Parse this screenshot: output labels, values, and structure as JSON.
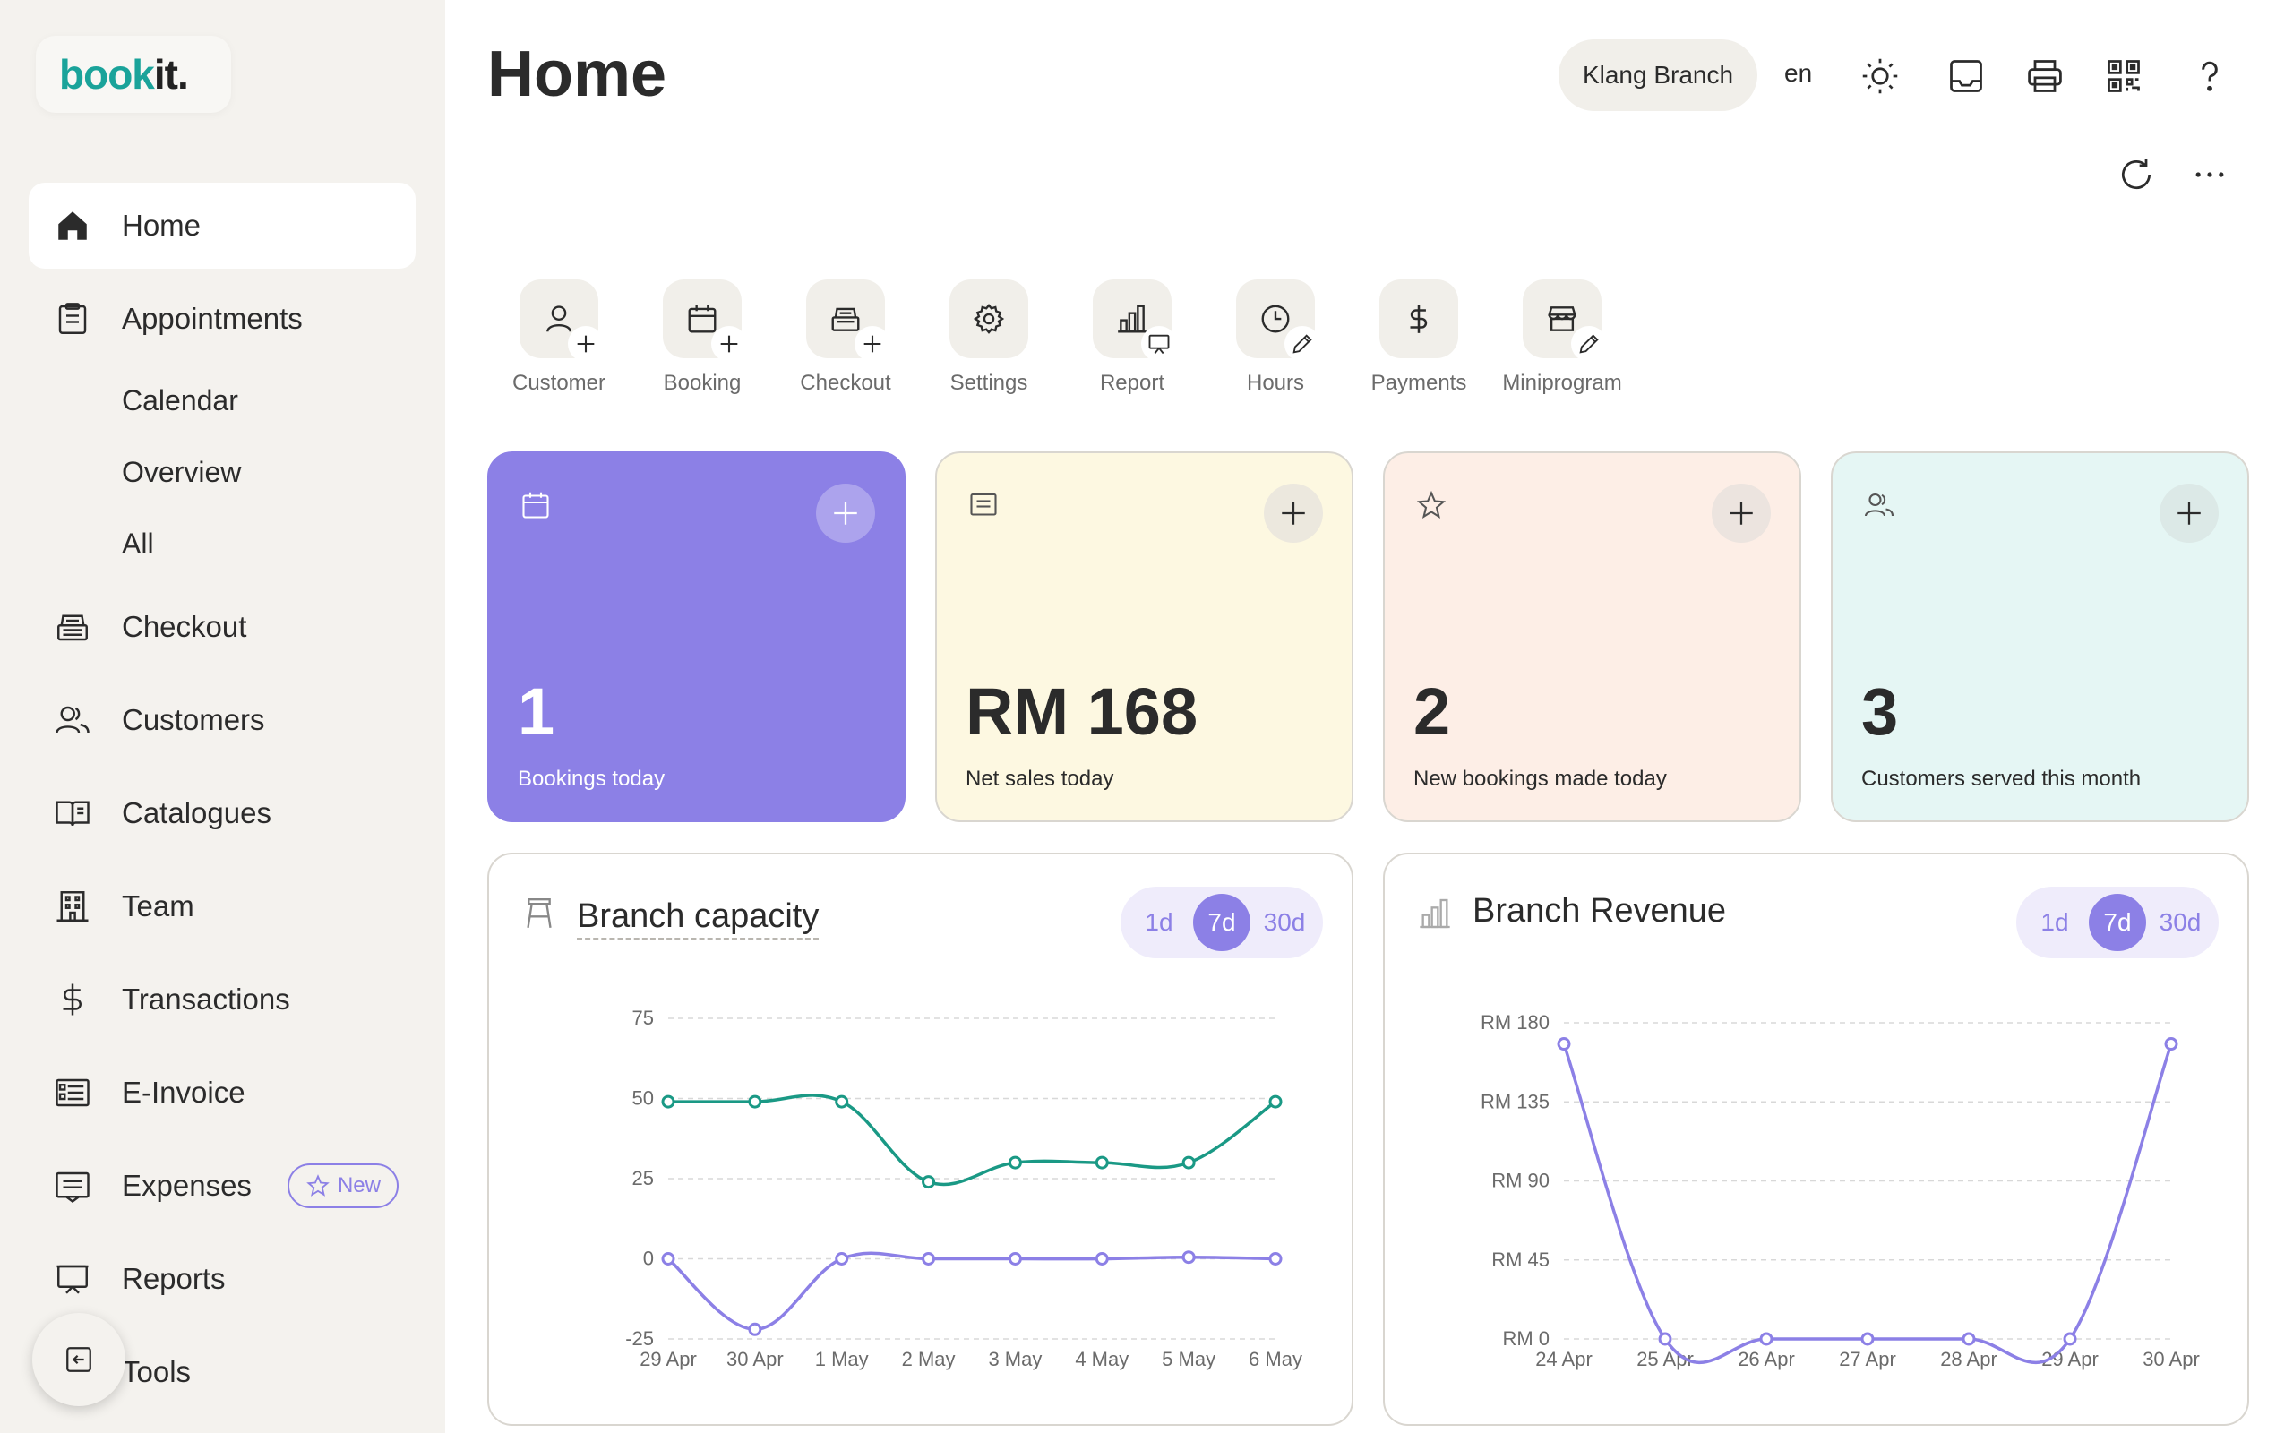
{
  "brand": {
    "part1": "book",
    "part2": "it."
  },
  "sidebar": {
    "items": [
      {
        "label": "Home",
        "icon": "home-icon"
      },
      {
        "label": "Appointments",
        "icon": "clipboard-icon"
      },
      {
        "label": "Checkout",
        "icon": "cash-register-icon"
      },
      {
        "label": "Customers",
        "icon": "users-icon"
      },
      {
        "label": "Catalogues",
        "icon": "book-icon"
      },
      {
        "label": "Team",
        "icon": "building-icon"
      },
      {
        "label": "Transactions",
        "icon": "dollar-icon"
      },
      {
        "label": "E-Invoice",
        "icon": "invoice-icon"
      },
      {
        "label": "Expenses",
        "icon": "receipt-icon"
      },
      {
        "label": "Reports",
        "icon": "presentation-icon"
      },
      {
        "label": "Tools",
        "icon": "tools-icon"
      }
    ],
    "sub_items": [
      "Calendar",
      "Overview",
      "All"
    ],
    "new_badge": "New"
  },
  "header": {
    "title": "Home",
    "branch": "Klang Branch",
    "language": "en"
  },
  "quick_actions": [
    {
      "label": "Customer",
      "icon": "user-icon",
      "badge": "plus-icon"
    },
    {
      "label": "Booking",
      "icon": "calendar-icon",
      "badge": "plus-icon"
    },
    {
      "label": "Checkout",
      "icon": "cash-register-icon",
      "badge": "plus-icon"
    },
    {
      "label": "Settings",
      "icon": "gear-icon",
      "badge": ""
    },
    {
      "label": "Report",
      "icon": "bar-chart-icon",
      "badge": "presentation-icon"
    },
    {
      "label": "Hours",
      "icon": "clock-icon",
      "badge": "pencil-icon"
    },
    {
      "label": "Payments",
      "icon": "dollar-icon",
      "badge": ""
    },
    {
      "label": "Miniprogram",
      "icon": "store-icon",
      "badge": "pencil-icon"
    }
  ],
  "stats": [
    {
      "value": "1",
      "label": "Bookings today",
      "icon": "calendar-icon",
      "bg": "#8c80e6",
      "fg": "#ffffff"
    },
    {
      "value": "RM 168",
      "label": "Net sales today",
      "icon": "receipt-icon",
      "bg": "#fdf8e1",
      "fg": "#2b2b2b"
    },
    {
      "value": "2",
      "label": "New bookings made today",
      "icon": "star-icon",
      "bg": "#fdeee6",
      "fg": "#2b2b2b"
    },
    {
      "value": "3",
      "label": "Customers served this month",
      "icon": "users-icon",
      "bg": "#e5f6f4",
      "fg": "#2b2b2b"
    }
  ],
  "ranges": [
    "1d",
    "7d",
    "30d"
  ],
  "selected_range": "7d",
  "colors": {
    "accent": "#8c80e6",
    "teal": "#1a9985",
    "text": "#2b2b2b"
  },
  "chart_data": [
    {
      "type": "line",
      "title": "Branch capacity",
      "categories": [
        "29 Apr",
        "30 Apr",
        "1 May",
        "2 May",
        "3 May",
        "4 May",
        "5 May",
        "6 May"
      ],
      "series": [
        {
          "color": "#1a9985",
          "values": [
            49,
            49,
            49,
            24,
            30,
            30,
            30,
            49
          ]
        },
        {
          "color": "#8c80e6",
          "values": [
            0,
            -22,
            0,
            0,
            0,
            0,
            0.5,
            0
          ]
        }
      ],
      "yticks": [
        75,
        50,
        25,
        0,
        -25
      ],
      "ylim": [
        -25,
        75
      ],
      "grid": true
    },
    {
      "type": "line",
      "title": "Branch Revenue",
      "categories": [
        "24 Apr",
        "25 Apr",
        "26 Apr",
        "27 Apr",
        "28 Apr",
        "29 Apr",
        "30 Apr"
      ],
      "series": [
        {
          "color": "#8c80e6",
          "values": [
            168,
            0,
            0,
            0,
            0,
            0,
            168
          ]
        }
      ],
      "yticks": [
        "RM 180",
        "RM 135",
        "RM 90",
        "RM 45",
        "RM 0"
      ],
      "ylim": [
        0,
        180
      ],
      "grid": true
    }
  ]
}
